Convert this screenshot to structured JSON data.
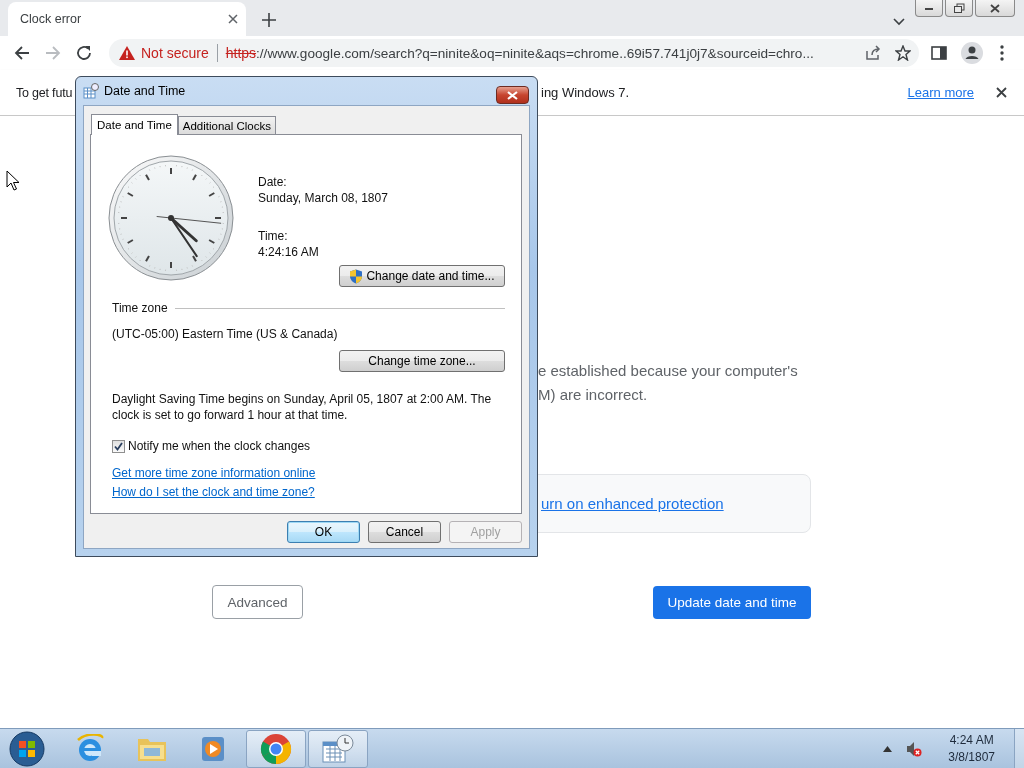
{
  "browser": {
    "tabs": [
      {
        "title": "Clock error",
        "selected": true
      }
    ],
    "nav": {
      "forward_enabled": false
    },
    "omnibox": {
      "security_label": "Not secure",
      "scheme": "https",
      "url_rest": "://www.google.com/search?q=ninite&oq=ninite&aqs=chrome..69i57.741j0j7&sourceid=chro..."
    },
    "infobar": {
      "text_start": "To get futu",
      "text_end": "ing Windows 7.",
      "link": "Learn more"
    }
  },
  "page": {
    "paragraph_lines": [
      "e established because your computer's",
      "M) are incorrect."
    ],
    "card_link": "urn on enhanced protection",
    "buttons": [
      {
        "label": "Advanced",
        "kind": "secondary"
      },
      {
        "label": "Update date and time",
        "kind": "primary"
      }
    ]
  },
  "dialog": {
    "title": "Date and Time",
    "tabs": [
      {
        "label": "Date and Time",
        "selected": true
      },
      {
        "label": "Additional Clocks",
        "selected": false
      }
    ],
    "date_label": "Date:",
    "date_value": "Sunday, March 08, 1807",
    "time_label": "Time:",
    "time_value": "4:24:16 AM",
    "change_datetime_button": "Change date and time...",
    "time_zone_heading": "Time zone",
    "time_zone": "(UTC-05:00) Eastern Time (US & Canada)",
    "change_zone_button": "Change time zone...",
    "dst_note": "Daylight Saving Time begins on Sunday, April 05, 1807 at 2:00 AM. The clock is set to go forward 1 hour at that time.",
    "checkbox": {
      "label": "Notify me when the clock changes",
      "checked": true
    },
    "links": [
      "Get more time zone information online",
      "How do I set the clock and time zone?"
    ],
    "buttons": [
      {
        "label": "OK",
        "default": true,
        "disabled": false
      },
      {
        "label": "Cancel",
        "default": false,
        "disabled": false
      },
      {
        "label": "Apply",
        "default": false,
        "disabled": true
      }
    ]
  },
  "taskbar": {
    "apps": [
      {
        "kind": "ie",
        "active": false
      },
      {
        "kind": "explorer",
        "active": false
      },
      {
        "kind": "media",
        "active": false
      },
      {
        "kind": "chrome",
        "active": true
      },
      {
        "kind": "datetime",
        "active": true
      }
    ],
    "clock": {
      "time": "4:24 AM",
      "date": "3/8/1807"
    }
  }
}
